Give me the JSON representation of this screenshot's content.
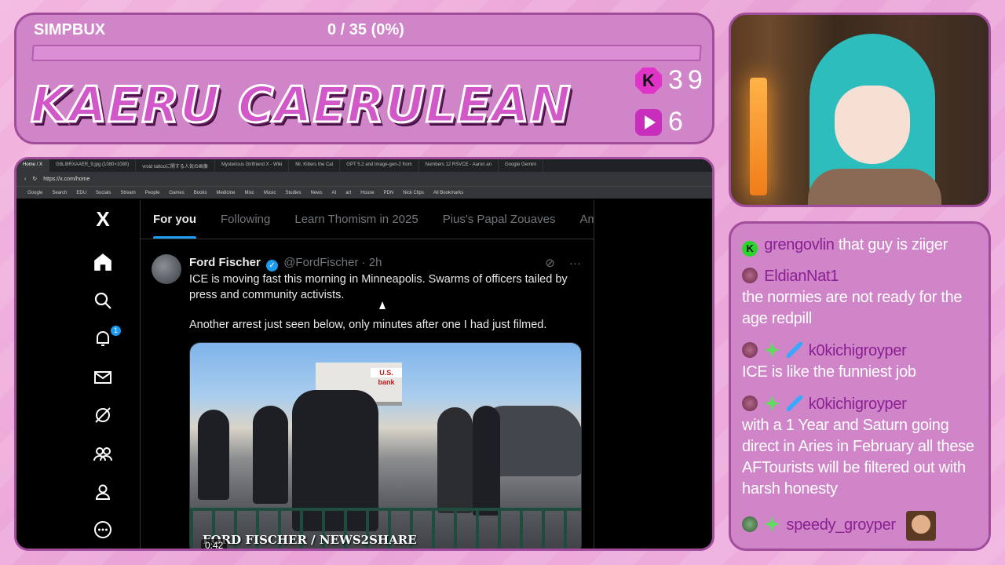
{
  "overlay": {
    "goal_label": "SIMPBUX",
    "goal_progress_text": "0 / 35 (0%)",
    "goal_progress_fraction": 0,
    "streamer_name": "KAERU CAERULEAN",
    "kick_badge_letter": "K",
    "kick_count": "39",
    "twitch_count": "6",
    "colors": {
      "panel": "#cf85c8",
      "border": "#a24d9c",
      "username": "#8a1e93",
      "accent": "#1d9bf0"
    }
  },
  "browser": {
    "tabs": [
      "Home / X",
      "G8LI8RXAAER_9.jpg (1080×1080)",
      "vroid tattooに関する人気の画像",
      "Mysterious Girlfriend X - Wiki",
      "Mr. Kitters the Cat",
      "GPT 5.2 and Image-gen-2 from",
      "Numbers 12 RSVCE - Aaron an",
      "Google Gemini"
    ],
    "url": "https://x.com/home",
    "bookmarks": [
      "Google",
      "Search",
      "EDU",
      "Socials",
      "Stream",
      "People",
      "Games",
      "Books",
      "Medicine",
      "Misc",
      "Music",
      "Studies",
      "News",
      "AI",
      "art",
      "House",
      "PDN",
      "Nick Clips",
      "All Bookmarks"
    ]
  },
  "x": {
    "logo": "X",
    "nav_icons": [
      "home-icon",
      "search-icon",
      "bell-icon",
      "mail-icon",
      "grok-icon",
      "communities-icon",
      "profile-icon",
      "more-icon"
    ],
    "notification_count": "1",
    "feed_tabs": [
      "For you",
      "Following",
      "Learn Thomism in 2025",
      "Pius's Papal Zouaves",
      "Am"
    ],
    "tweet": {
      "author": "Ford Fischer",
      "handle": "@FordFischer",
      "separator": "·",
      "time": "2h",
      "text_1": "ICE is moving fast this morning in Minneapolis. Swarms of officers tailed by press and community activists.",
      "text_2": "Another arrest just seen below, only minutes after one I had just filmed.",
      "media_watermark": "FORD FISCHER / NEWS2SHARE",
      "media_sign": "U.S. bank",
      "media_duration": "0:42"
    }
  },
  "chat": {
    "messages": [
      {
        "user": "grengovlin",
        "text": "that guy is ziiger"
      },
      {
        "user": "EldianNat1",
        "text": "the normies are not ready for the age redpill"
      },
      {
        "user": "k0kichigroyper",
        "text": "ICE is like the funniest job"
      },
      {
        "user": "k0kichigroyper",
        "text": "with a 1 Year and Saturn going direct in Aries in February all these AFTourists will be filtered out with harsh honesty"
      },
      {
        "user": "speedy_groyper",
        "text": ""
      }
    ]
  }
}
